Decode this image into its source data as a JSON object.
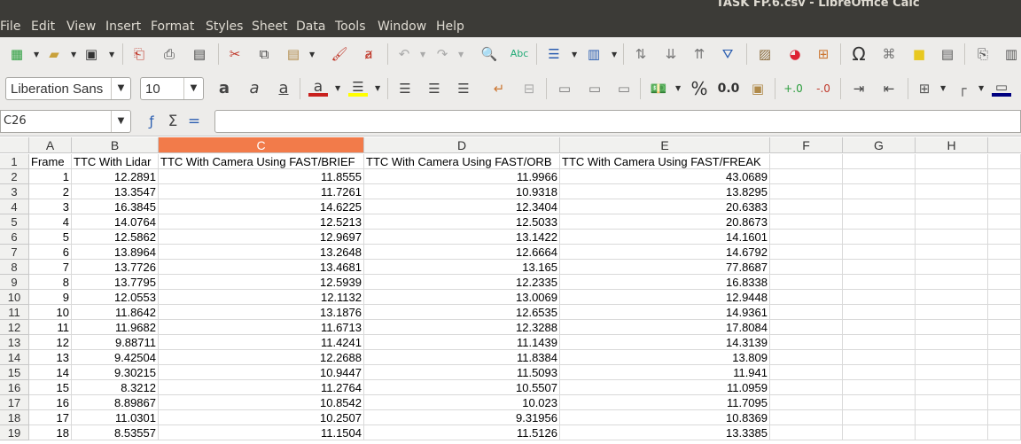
{
  "window": {
    "title": "TASK FP.6.csv - LibreOffice Calc"
  },
  "menu": [
    "File",
    "Edit",
    "View",
    "Insert",
    "Format",
    "Styles",
    "Sheet",
    "Data",
    "Tools",
    "Window",
    "Help"
  ],
  "toolbar": {
    "font_name": "Liberation Sans",
    "font_size": "10",
    "percent_label": "%",
    "decimal_label": "0.0"
  },
  "formula_bar": {
    "name_box": "C26",
    "formula": ""
  },
  "sheet": {
    "columns": [
      "A",
      "B",
      "C",
      "D",
      "E",
      "F",
      "G",
      "H"
    ],
    "selected_column": "C",
    "header_row": [
      "Frame",
      "TTC With Lidar",
      "TTC With Camera Using FAST/BRIEF",
      "TTC With Camera Using FAST/ORB",
      "TTC With Camera Using FAST/FREAK"
    ],
    "row_numbers": [
      "1",
      "2",
      "3",
      "4",
      "5",
      "6",
      "7",
      "8",
      "9",
      "10",
      "11",
      "12",
      "13",
      "14",
      "15",
      "16",
      "17",
      "18",
      "19"
    ],
    "rows": [
      [
        "1",
        "12.2891",
        "11.8555",
        "11.9966",
        "43.0689"
      ],
      [
        "2",
        "13.3547",
        "11.7261",
        "10.9318",
        "13.8295"
      ],
      [
        "3",
        "16.3845",
        "14.6225",
        "12.3404",
        "20.6383"
      ],
      [
        "4",
        "14.0764",
        "12.5213",
        "12.5033",
        "20.8673"
      ],
      [
        "5",
        "12.5862",
        "12.9697",
        "13.1422",
        "14.1601"
      ],
      [
        "6",
        "13.8964",
        "13.2648",
        "12.6664",
        "14.6792"
      ],
      [
        "7",
        "13.7726",
        "13.4681",
        "13.165",
        "77.8687"
      ],
      [
        "8",
        "13.7795",
        "12.5939",
        "12.2335",
        "16.8338"
      ],
      [
        "9",
        "12.0553",
        "12.1132",
        "13.0069",
        "12.9448"
      ],
      [
        "10",
        "11.8642",
        "13.1876",
        "12.6535",
        "14.9361"
      ],
      [
        "11",
        "11.9682",
        "11.6713",
        "12.3288",
        "17.8084"
      ],
      [
        "12",
        "9.88711",
        "11.4241",
        "11.1439",
        "14.3139"
      ],
      [
        "13",
        "9.42504",
        "12.2688",
        "11.8384",
        "13.809"
      ],
      [
        "14",
        "9.30215",
        "10.9447",
        "11.5093",
        "11.941"
      ],
      [
        "15",
        "8.3212",
        "11.2764",
        "10.5507",
        "11.0959"
      ],
      [
        "16",
        "8.89867",
        "10.8542",
        "10.023",
        "11.7095"
      ],
      [
        "17",
        "11.0301",
        "10.2507",
        "9.31956",
        "10.8369"
      ],
      [
        "18",
        "8.53557",
        "11.1504",
        "11.5126",
        "13.3385"
      ]
    ]
  }
}
